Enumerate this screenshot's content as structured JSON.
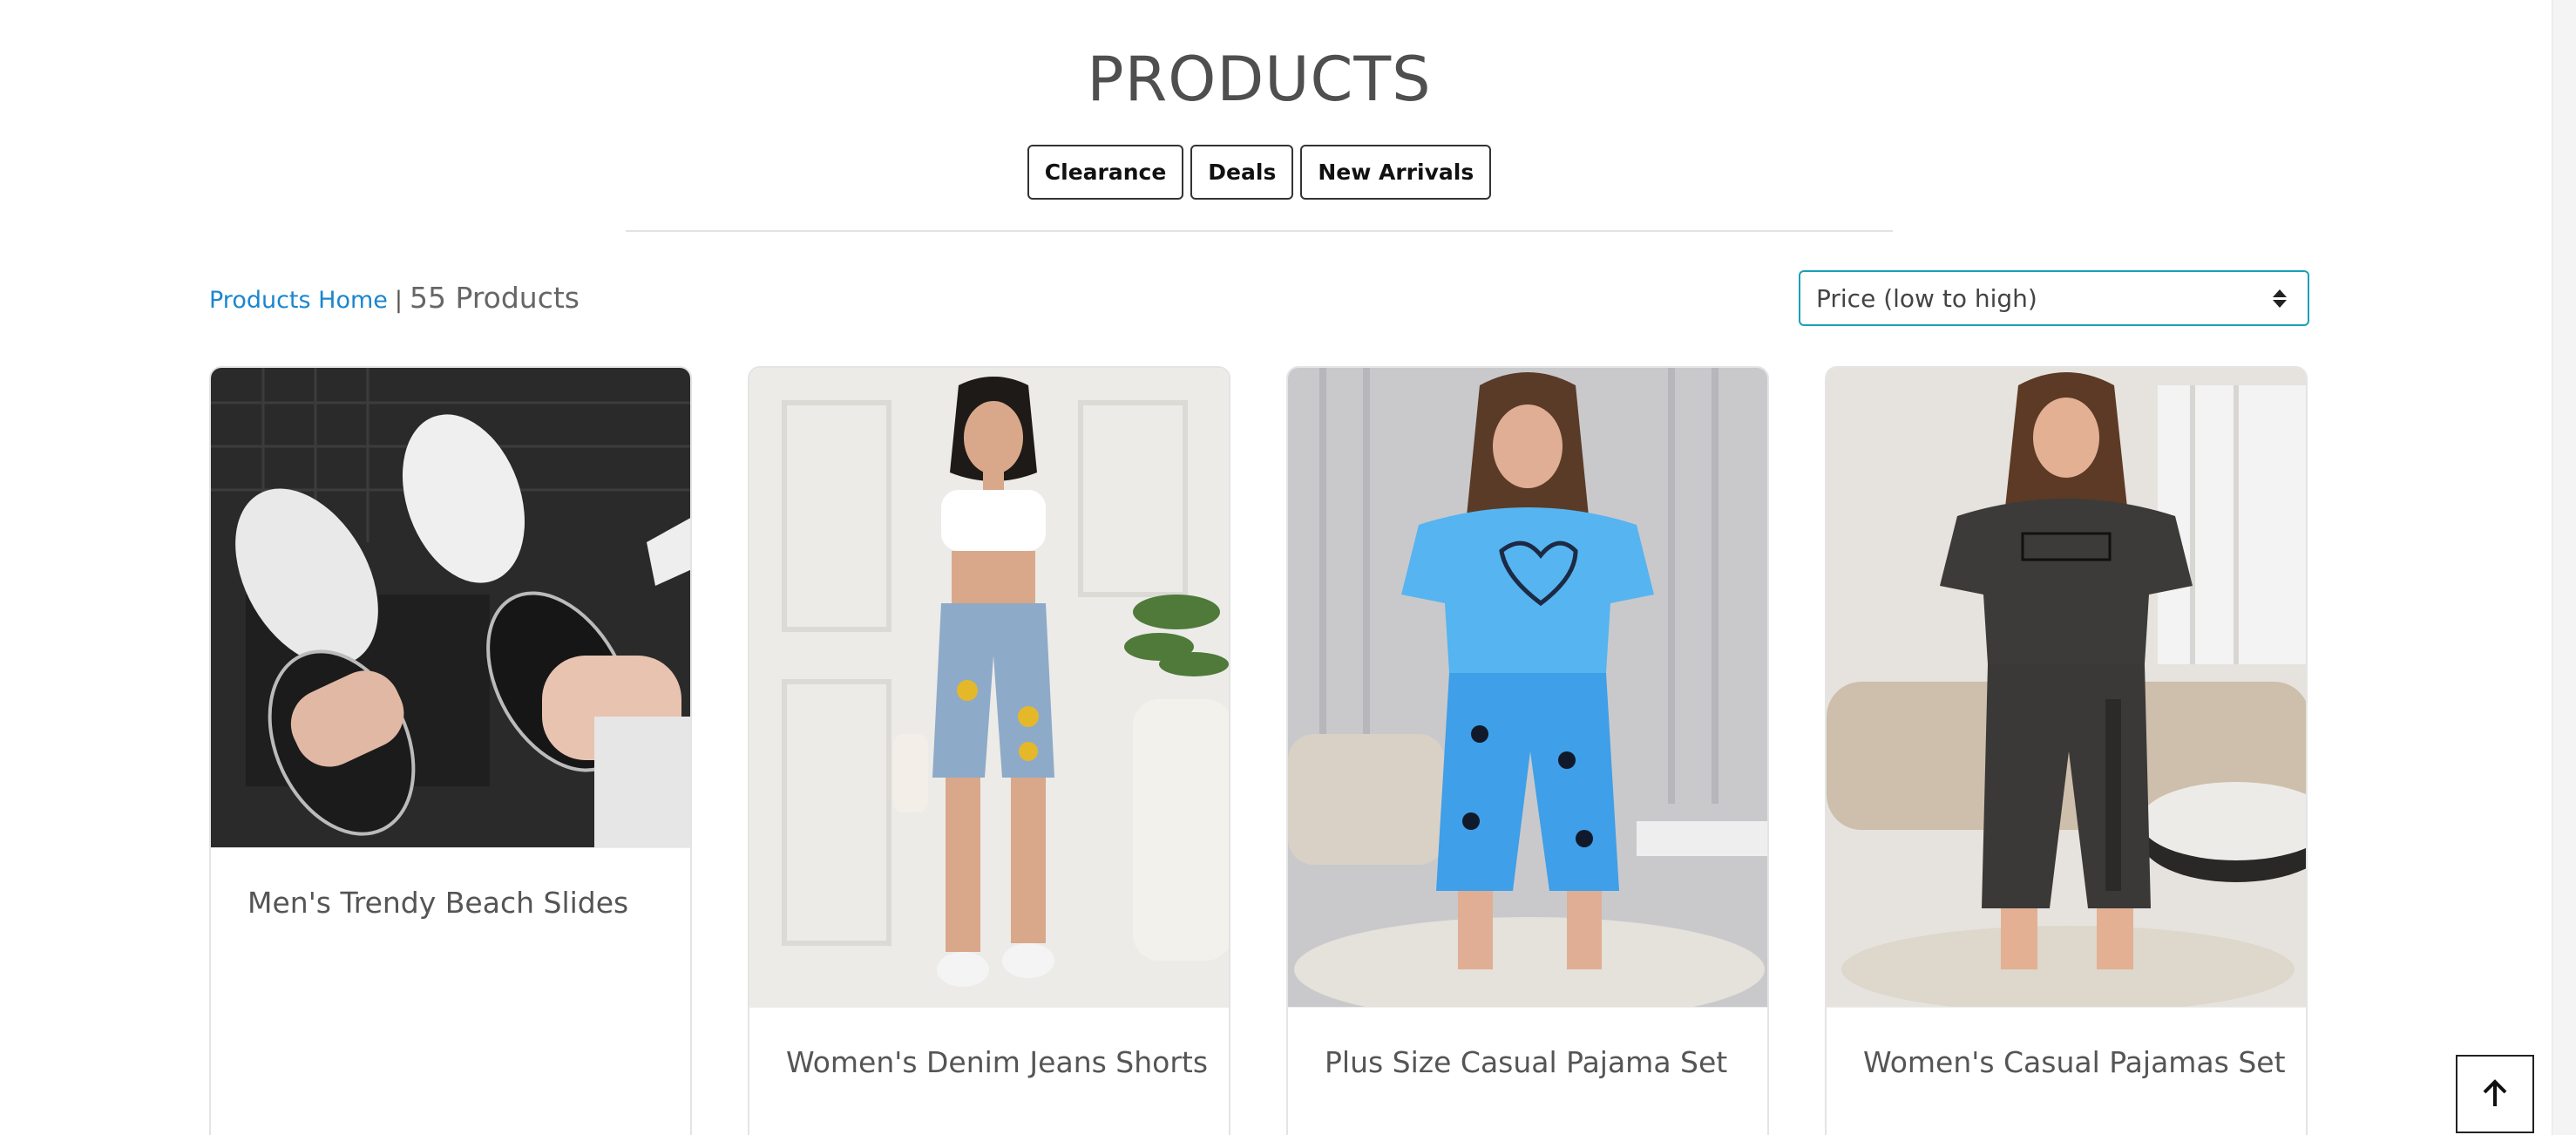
{
  "header": {
    "title": "PRODUCTS",
    "filters": [
      "Clearance",
      "Deals",
      "New Arrivals"
    ]
  },
  "toolbar": {
    "breadcrumb_link": "Products Home",
    "separator": "|",
    "product_count": "55 Products",
    "sort_selected": "Price (low to high)"
  },
  "products": [
    {
      "name": "Men's Trendy Beach Slides",
      "image": "black-and-white-slide-sandals-photo"
    },
    {
      "name": "Women's Denim Jeans Shorts",
      "image": "woman-in-denim-shorts-photo"
    },
    {
      "name": "Plus Size Casual Pajama Set",
      "image": "blue-butterfly-pajama-set-photo"
    },
    {
      "name": "Women's Casual Pajamas Set",
      "image": "grey-weekend-pajama-set-photo"
    }
  ],
  "icons": {
    "back_to_top": "arrow-up-icon",
    "sort": "sort-arrows-icon"
  },
  "colors": {
    "link": "#1a86d0",
    "select_border": "#1aa0b8"
  }
}
